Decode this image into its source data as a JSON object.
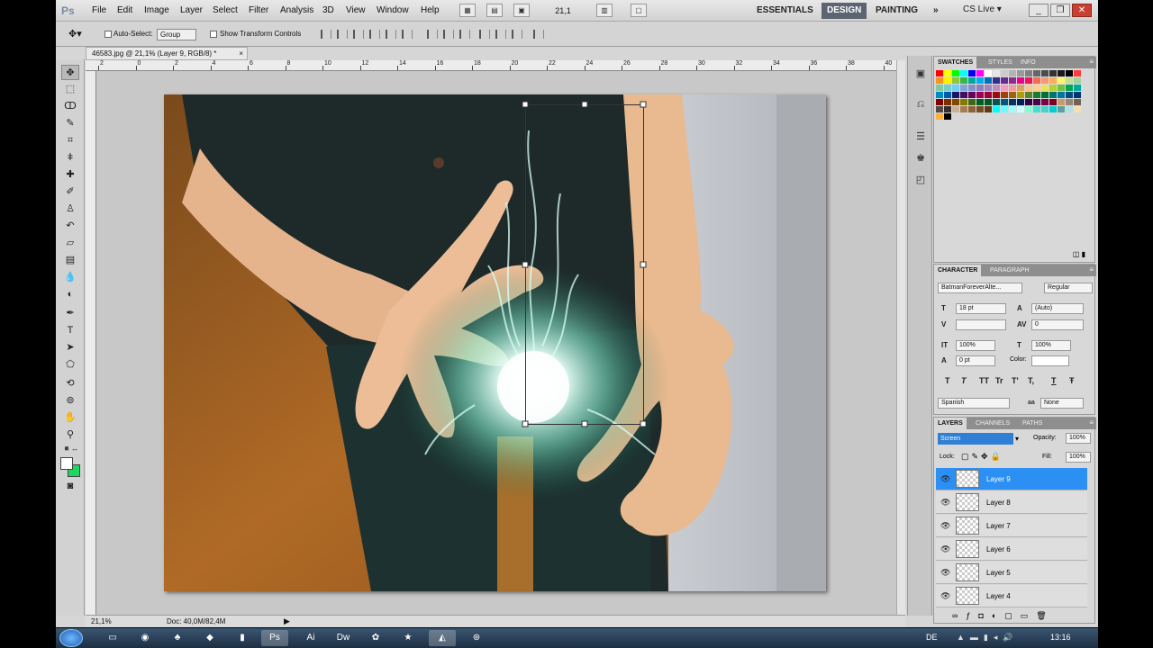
{
  "app": {
    "logo": "Ps"
  },
  "menu": [
    "File",
    "Edit",
    "Image",
    "Layer",
    "Select",
    "Filter",
    "Analysis",
    "3D",
    "View",
    "Window",
    "Help"
  ],
  "zoom_field": "21,1",
  "workspaces": {
    "essentials": "ESSENTIALS",
    "design": "DESIGN",
    "painting": "PAINTING",
    "more": "»"
  },
  "cs_live": "CS Live ▾",
  "options": {
    "auto_select": "Auto-Select:",
    "group": "Group",
    "show_transform": "Show Transform Controls"
  },
  "document_tab": {
    "title": "46583.jpg @ 21,1% (Layer 9, RGB/8) *",
    "close": "×"
  },
  "ruler_numbers": [
    "2",
    "0",
    "2",
    "4",
    "6",
    "8",
    "10",
    "12",
    "14",
    "16",
    "18",
    "20",
    "22",
    "24",
    "26",
    "28",
    "30",
    "32",
    "34",
    "36",
    "38",
    "40"
  ],
  "status": {
    "zoom": "21,1%",
    "doc": "Doc: 40,0M/82,4M"
  },
  "swatches": {
    "tabs": [
      "SWATCHES",
      "STYLES",
      "INFO"
    ],
    "colors": [
      "#ff0000",
      "#ffff00",
      "#00ff00",
      "#00ffff",
      "#0000ff",
      "#ff00ff",
      "#ffffff",
      "#e6e6e6",
      "#cccccc",
      "#b3b3b3",
      "#999999",
      "#808080",
      "#666666",
      "#4d4d4d",
      "#333333",
      "#1a1a1a",
      "#000000",
      "#ff3c3c",
      "#f7941d",
      "#fff200",
      "#8dc63f",
      "#39b54a",
      "#00a99d",
      "#00aeef",
      "#0072bc",
      "#2e3192",
      "#662d91",
      "#92278f",
      "#ec008c",
      "#ed145b",
      "#f26c4f",
      "#f7977a",
      "#fbaf5d",
      "#fff568",
      "#c4df9b",
      "#a3d39c",
      "#82ca9c",
      "#7accc8",
      "#6dcff6",
      "#7da7d9",
      "#8393ca",
      "#8781bd",
      "#a186be",
      "#bd8cbf",
      "#f49ac1",
      "#f5989d",
      "#e1a05f",
      "#fdc68a",
      "#ffd08a",
      "#ede15b",
      "#b2d234",
      "#72bf44",
      "#00a651",
      "#00a99d",
      "#0088cc",
      "#005baa",
      "#1b1464",
      "#440e62",
      "#630460",
      "#9e005d",
      "#9e0039",
      "#9e0b0f",
      "#a0410d",
      "#a36209",
      "#aba000",
      "#598527",
      "#197b30",
      "#007236",
      "#00746b",
      "#0076a3",
      "#004a80",
      "#003471",
      "#790000",
      "#7b2e00",
      "#7d4900",
      "#827b00",
      "#406618",
      "#005e20",
      "#005826",
      "#005952",
      "#005b7f",
      "#003663",
      "#002157",
      "#32004b",
      "#4b0049",
      "#7b0046",
      "#7a0026",
      "#c69c6d",
      "#998675",
      "#736357",
      "#534741",
      "#362f2d",
      "#c7b299",
      "#a67c52",
      "#8c6239",
      "#754c24",
      "#603913",
      "#00ffff",
      "#66ffff",
      "#99ffff",
      "#ccffff",
      "#7fffd4",
      "#40e0d0",
      "#48d1cc",
      "#00ced1",
      "#5f9ea0",
      "#b0e0e6",
      "#f5deb3",
      "#fbb040",
      "#000000"
    ]
  },
  "character": {
    "tabs": [
      "CHARACTER",
      "PARAGRAPH"
    ],
    "font": "BatmanForeverAlte...",
    "style": "Regular",
    "size": "18 pt",
    "leading": "(Auto)",
    "kerning": "",
    "tracking": "0",
    "vscale": "100%",
    "hscale": "100%",
    "baseline": "0 pt",
    "color_label": "Color:",
    "language": "Spanish",
    "aa_label": "aa",
    "aa": "None",
    "buttons": [
      "T",
      "T",
      "TT",
      "Tr",
      "T'",
      "T,",
      "T",
      "Ŧ"
    ]
  },
  "layers": {
    "tabs": [
      "LAYERS",
      "CHANNELS",
      "PATHS"
    ],
    "blend_mode": "Screen",
    "opacity_label": "Opacity:",
    "opacity": "100%",
    "lock_label": "Lock:",
    "fill_label": "Fill:",
    "fill": "100%",
    "items": [
      {
        "name": "Layer 9",
        "selected": true
      },
      {
        "name": "Layer 8",
        "selected": false
      },
      {
        "name": "Layer 7",
        "selected": false
      },
      {
        "name": "Layer 6",
        "selected": false
      },
      {
        "name": "Layer 5",
        "selected": false
      },
      {
        "name": "Layer 4",
        "selected": false
      }
    ]
  },
  "taskbar": {
    "lang": "DE",
    "clock": "13:16"
  },
  "accent_color": "#2b8ff3"
}
